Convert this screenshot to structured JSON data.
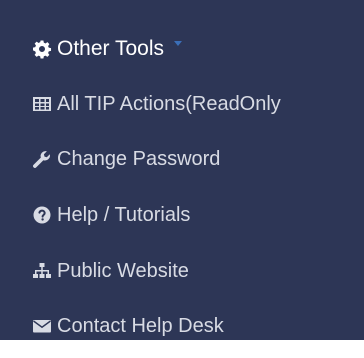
{
  "menu": {
    "header": {
      "label": "Other Tools",
      "icon": "gear-icon"
    },
    "items": [
      {
        "label": "All TIP Actions(ReadOnly",
        "icon": "table-icon"
      },
      {
        "label": "Change Password",
        "icon": "wrench-icon"
      },
      {
        "label": "Help / Tutorials",
        "icon": "question-circle-icon"
      },
      {
        "label": "Public Website",
        "icon": "sitemap-icon"
      },
      {
        "label": "Contact Help Desk",
        "icon": "envelope-icon"
      }
    ]
  },
  "colors": {
    "background": "#2d3656",
    "header_text": "#ffffff",
    "item_text": "#d8dbe4",
    "caret": "#3b6fb8"
  }
}
